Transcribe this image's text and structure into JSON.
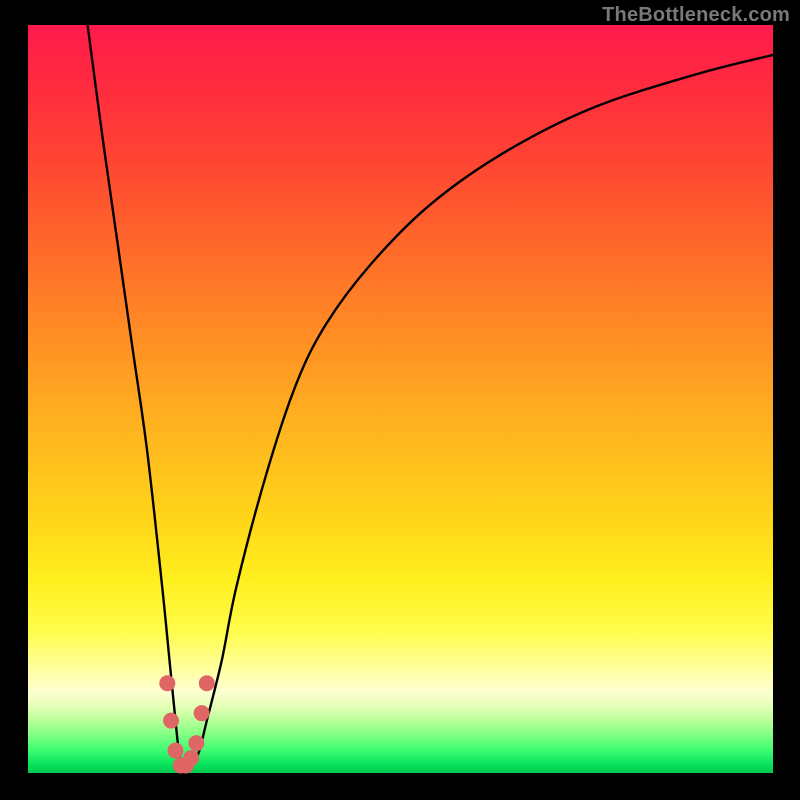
{
  "attribution": "TheBottleneck.com",
  "colors": {
    "background": "#000000",
    "gradient_top": "#ff1a4b",
    "gradient_bottom": "#04c64f",
    "curve": "#000000",
    "markers": "#e06565"
  },
  "chart_data": {
    "type": "line",
    "title": "",
    "xlabel": "",
    "ylabel": "",
    "xlim": [
      0,
      100
    ],
    "ylim": [
      0,
      100
    ],
    "series": [
      {
        "name": "bottleneck-curve",
        "x": [
          8,
          10,
          12,
          14,
          16,
          18,
          19,
          20,
          20.5,
          21,
          22,
          23,
          24,
          26,
          28,
          32,
          36,
          40,
          46,
          54,
          64,
          76,
          90,
          100
        ],
        "values": [
          100,
          85,
          71,
          57,
          43,
          25,
          15,
          5,
          1,
          0.5,
          1,
          3,
          7,
          15,
          25,
          40,
          52,
          60,
          68,
          76,
          83,
          89,
          93.5,
          96
        ]
      }
    ],
    "annotations": {
      "markers": {
        "shape": "circle",
        "color": "#e06565",
        "points": [
          {
            "x": 18.7,
            "y": 12
          },
          {
            "x": 19.2,
            "y": 7
          },
          {
            "x": 19.8,
            "y": 3
          },
          {
            "x": 20.5,
            "y": 1
          },
          {
            "x": 21.2,
            "y": 1
          },
          {
            "x": 21.9,
            "y": 2
          },
          {
            "x": 22.6,
            "y": 4
          },
          {
            "x": 23.3,
            "y": 8
          },
          {
            "x": 24.0,
            "y": 12
          }
        ]
      }
    }
  }
}
